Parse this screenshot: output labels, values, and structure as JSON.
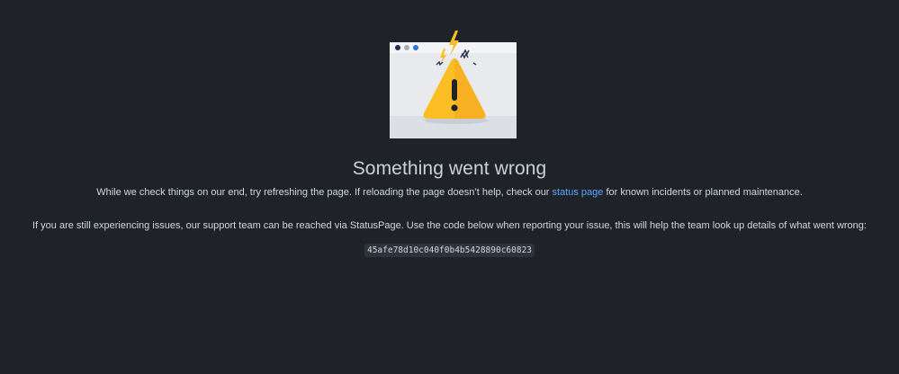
{
  "error": {
    "title": "Something went wrong",
    "line1_before": "While we check things on our end, try refreshing the page. If reloading the page doesn’t help, check our ",
    "status_link": "status page",
    "line1_after": " for known incidents or planned maintenance.",
    "line2": "If you are still experiencing issues, our support team can be reached via StatusPage. Use the code below when reporting your issue, this will help the team look up details of what went wrong:",
    "code": "45afe78d10c040f0b4b5428890c60823"
  },
  "colors": {
    "background": "#1f2328",
    "link": "#58a6ff",
    "warning": "#fbbf24"
  },
  "icons": [
    "browser-window-icon",
    "warning-triangle-icon",
    "lightning-bolt-icon"
  ]
}
